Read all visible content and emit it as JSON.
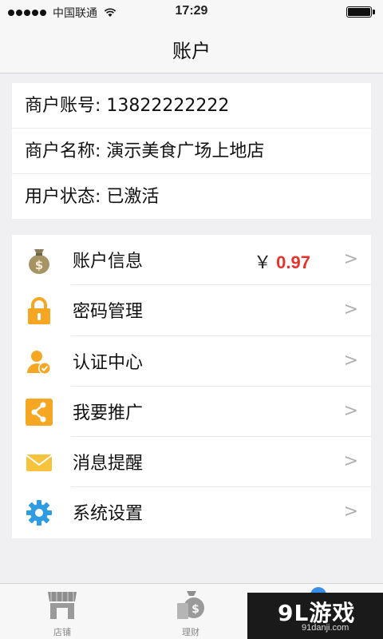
{
  "status_bar": {
    "carrier": "中国联通",
    "time": "17:29"
  },
  "nav": {
    "title": "账户"
  },
  "account_info": {
    "merchant_id": "商户账号: 13822222222",
    "merchant_name": "商户名称: 演示美食广场上地店",
    "user_status": "用户状态: 已激活"
  },
  "menu": {
    "items": [
      {
        "label": "账户信息",
        "icon": "money-bag-icon"
      },
      {
        "label": "密码管理",
        "icon": "lock-icon"
      },
      {
        "label": "认证中心",
        "icon": "user-verified-icon"
      },
      {
        "label": "我要推广",
        "icon": "share-icon"
      },
      {
        "label": "消息提醒",
        "icon": "envelope-icon"
      },
      {
        "label": "系统设置",
        "icon": "gear-icon"
      }
    ],
    "balance_currency": "￥",
    "balance_amount": "0.97",
    "chevron": ">"
  },
  "tabs": [
    {
      "label": "店铺",
      "icon": "store-icon"
    },
    {
      "label": "理财",
      "icon": "finance-bag-icon"
    }
  ],
  "watermark": {
    "main": "9L游戏",
    "sub": "91danji.com"
  },
  "colors": {
    "accent_orange": "#f5a623",
    "balance_red": "#e8332c",
    "gear_blue": "#2f9be0"
  }
}
